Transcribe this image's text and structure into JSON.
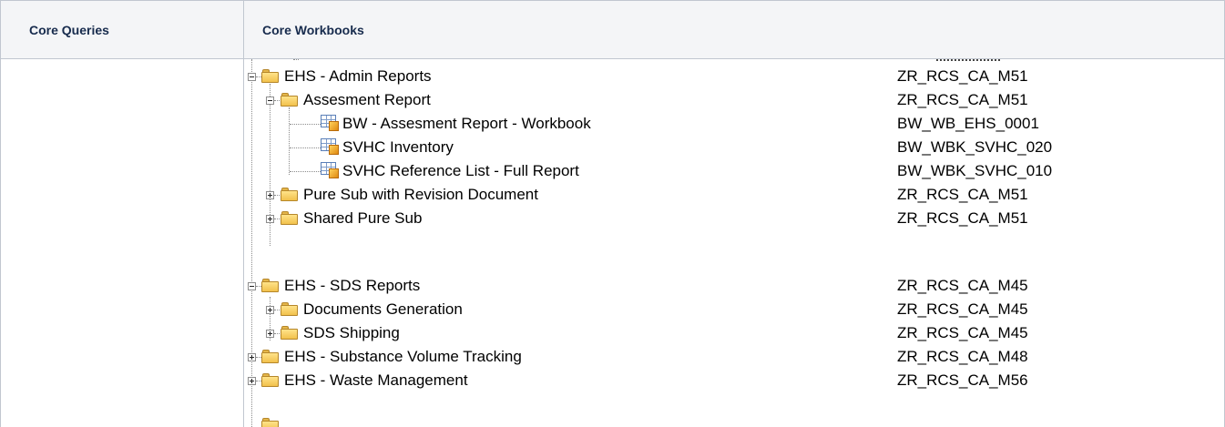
{
  "table": {
    "headers": [
      "Core Queries",
      "Core Workbooks"
    ]
  },
  "tree": {
    "rows": [
      {
        "label": "EHS - Admin Reports",
        "code": "ZR_RCS_CA_M51"
      },
      {
        "label": "Assesment Report",
        "code": "ZR_RCS_CA_M51"
      },
      {
        "label": "BW - Assesment Report - Workbook",
        "code": "BW_WB_EHS_0001"
      },
      {
        "label": "SVHC Inventory",
        "code": "BW_WBK_SVHC_020"
      },
      {
        "label": "SVHC Reference List - Full Report",
        "code": "BW_WBK_SVHC_010"
      },
      {
        "label": "Pure Sub with Revision Document",
        "code": "ZR_RCS_CA_M51"
      },
      {
        "label": "Shared Pure Sub",
        "code": "ZR_RCS_CA_M51"
      },
      {
        "label": "EHS - SDS Reports",
        "code": "ZR_RCS_CA_M45"
      },
      {
        "label": "Documents Generation",
        "code": "ZR_RCS_CA_M45"
      },
      {
        "label": "SDS Shipping",
        "code": "ZR_RCS_CA_M45"
      },
      {
        "label": "EHS - Substance Volume Tracking",
        "code": "ZR_RCS_CA_M48"
      },
      {
        "label": "EHS - Waste Management",
        "code": "ZR_RCS_CA_M56"
      }
    ]
  }
}
